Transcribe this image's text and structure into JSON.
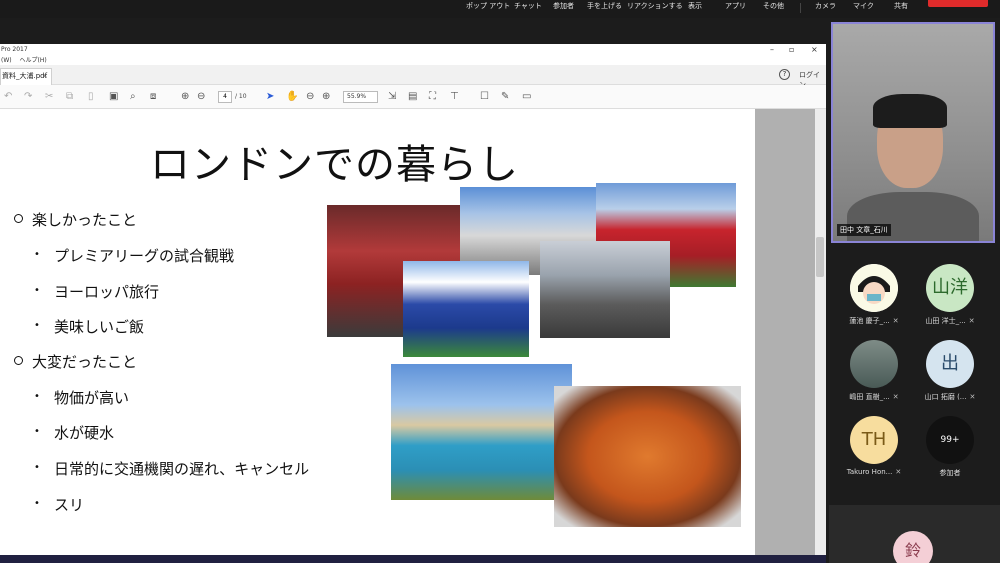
{
  "topbar": {
    "buttons": [
      "ポップ アウト",
      "チャット",
      "参加者",
      "手を上げる",
      "リアクションする",
      "表示",
      "アプリ",
      "その他",
      "カメラ",
      "マイク",
      "共有"
    ]
  },
  "acrobat": {
    "window_title": "Pro 2017",
    "menus": [
      "(W)",
      "ヘルプ(H)"
    ],
    "tab_label": "資料_大浦.pdf",
    "tab_close": "×",
    "help": "?",
    "login": "ログイン",
    "page_current": "4",
    "page_total": "/ 10",
    "zoom": "55.9%"
  },
  "slide": {
    "title": "ロンドンでの暮らし",
    "section1": "楽しかったこと",
    "items1": [
      "プレミアリーグの試合観戦",
      "ヨーロッパ旅行",
      "美味しいご飯"
    ],
    "section2": "大変だったこと",
    "items2": [
      "物価が高い",
      "水が硬水",
      "日常的に交通機関の遅れ、キャンセル",
      "スリ"
    ]
  },
  "participants": {
    "main_name": "田中 文章_石川",
    "tiles": [
      {
        "label": "蓮池 慶子_...",
        "initials": "",
        "bg": "#ffffff"
      },
      {
        "label": "山田 洋士_...",
        "initials": "山洋",
        "bg": "#c9e7c4"
      },
      {
        "label": "嶋田 直樹_...",
        "initials": "",
        "bg": "#5a6f6c"
      },
      {
        "label": "山口 拓磨 (...",
        "initials": "出",
        "bg": "#d5e4ef"
      },
      {
        "label": "Takuro Hon...",
        "initials": "TH",
        "bg": "#f7dd9e"
      },
      {
        "label": "参加者",
        "initials": "99+",
        "bg": "#111111"
      }
    ],
    "bottom_initials": "鈴"
  }
}
